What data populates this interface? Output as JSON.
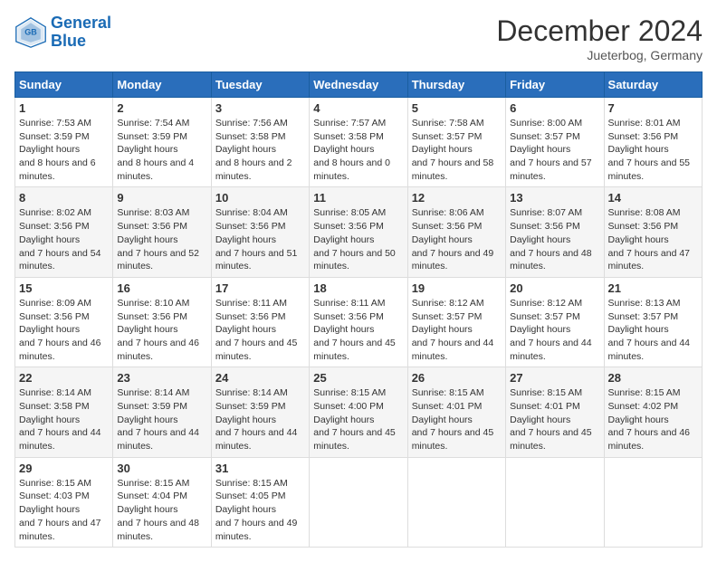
{
  "logo": {
    "line1": "General",
    "line2": "Blue"
  },
  "title": "December 2024",
  "subtitle": "Jueterbog, Germany",
  "weekdays": [
    "Sunday",
    "Monday",
    "Tuesday",
    "Wednesday",
    "Thursday",
    "Friday",
    "Saturday"
  ],
  "weeks": [
    [
      {
        "day": "1",
        "sunrise": "7:53 AM",
        "sunset": "3:59 PM",
        "daylight": "8 hours and 6 minutes."
      },
      {
        "day": "2",
        "sunrise": "7:54 AM",
        "sunset": "3:59 PM",
        "daylight": "8 hours and 4 minutes."
      },
      {
        "day": "3",
        "sunrise": "7:56 AM",
        "sunset": "3:58 PM",
        "daylight": "8 hours and 2 minutes."
      },
      {
        "day": "4",
        "sunrise": "7:57 AM",
        "sunset": "3:58 PM",
        "daylight": "8 hours and 0 minutes."
      },
      {
        "day": "5",
        "sunrise": "7:58 AM",
        "sunset": "3:57 PM",
        "daylight": "7 hours and 58 minutes."
      },
      {
        "day": "6",
        "sunrise": "8:00 AM",
        "sunset": "3:57 PM",
        "daylight": "7 hours and 57 minutes."
      },
      {
        "day": "7",
        "sunrise": "8:01 AM",
        "sunset": "3:56 PM",
        "daylight": "7 hours and 55 minutes."
      }
    ],
    [
      {
        "day": "8",
        "sunrise": "8:02 AM",
        "sunset": "3:56 PM",
        "daylight": "7 hours and 54 minutes."
      },
      {
        "day": "9",
        "sunrise": "8:03 AM",
        "sunset": "3:56 PM",
        "daylight": "7 hours and 52 minutes."
      },
      {
        "day": "10",
        "sunrise": "8:04 AM",
        "sunset": "3:56 PM",
        "daylight": "7 hours and 51 minutes."
      },
      {
        "day": "11",
        "sunrise": "8:05 AM",
        "sunset": "3:56 PM",
        "daylight": "7 hours and 50 minutes."
      },
      {
        "day": "12",
        "sunrise": "8:06 AM",
        "sunset": "3:56 PM",
        "daylight": "7 hours and 49 minutes."
      },
      {
        "day": "13",
        "sunrise": "8:07 AM",
        "sunset": "3:56 PM",
        "daylight": "7 hours and 48 minutes."
      },
      {
        "day": "14",
        "sunrise": "8:08 AM",
        "sunset": "3:56 PM",
        "daylight": "7 hours and 47 minutes."
      }
    ],
    [
      {
        "day": "15",
        "sunrise": "8:09 AM",
        "sunset": "3:56 PM",
        "daylight": "7 hours and 46 minutes."
      },
      {
        "day": "16",
        "sunrise": "8:10 AM",
        "sunset": "3:56 PM",
        "daylight": "7 hours and 46 minutes."
      },
      {
        "day": "17",
        "sunrise": "8:11 AM",
        "sunset": "3:56 PM",
        "daylight": "7 hours and 45 minutes."
      },
      {
        "day": "18",
        "sunrise": "8:11 AM",
        "sunset": "3:56 PM",
        "daylight": "7 hours and 45 minutes."
      },
      {
        "day": "19",
        "sunrise": "8:12 AM",
        "sunset": "3:57 PM",
        "daylight": "7 hours and 44 minutes."
      },
      {
        "day": "20",
        "sunrise": "8:12 AM",
        "sunset": "3:57 PM",
        "daylight": "7 hours and 44 minutes."
      },
      {
        "day": "21",
        "sunrise": "8:13 AM",
        "sunset": "3:57 PM",
        "daylight": "7 hours and 44 minutes."
      }
    ],
    [
      {
        "day": "22",
        "sunrise": "8:14 AM",
        "sunset": "3:58 PM",
        "daylight": "7 hours and 44 minutes."
      },
      {
        "day": "23",
        "sunrise": "8:14 AM",
        "sunset": "3:59 PM",
        "daylight": "7 hours and 44 minutes."
      },
      {
        "day": "24",
        "sunrise": "8:14 AM",
        "sunset": "3:59 PM",
        "daylight": "7 hours and 44 minutes."
      },
      {
        "day": "25",
        "sunrise": "8:15 AM",
        "sunset": "4:00 PM",
        "daylight": "7 hours and 45 minutes."
      },
      {
        "day": "26",
        "sunrise": "8:15 AM",
        "sunset": "4:01 PM",
        "daylight": "7 hours and 45 minutes."
      },
      {
        "day": "27",
        "sunrise": "8:15 AM",
        "sunset": "4:01 PM",
        "daylight": "7 hours and 45 minutes."
      },
      {
        "day": "28",
        "sunrise": "8:15 AM",
        "sunset": "4:02 PM",
        "daylight": "7 hours and 46 minutes."
      }
    ],
    [
      {
        "day": "29",
        "sunrise": "8:15 AM",
        "sunset": "4:03 PM",
        "daylight": "7 hours and 47 minutes."
      },
      {
        "day": "30",
        "sunrise": "8:15 AM",
        "sunset": "4:04 PM",
        "daylight": "7 hours and 48 minutes."
      },
      {
        "day": "31",
        "sunrise": "8:15 AM",
        "sunset": "4:05 PM",
        "daylight": "7 hours and 49 minutes."
      },
      null,
      null,
      null,
      null
    ]
  ]
}
